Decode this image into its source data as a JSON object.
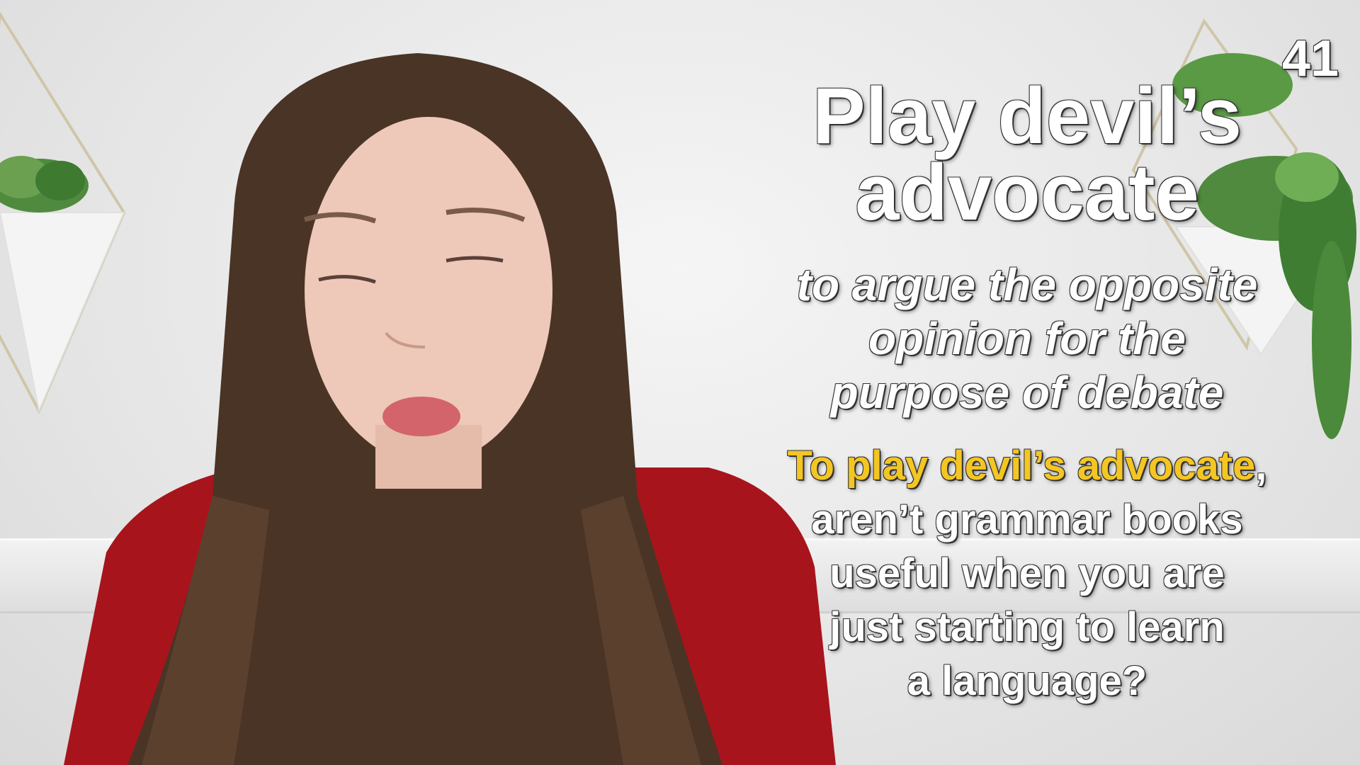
{
  "counter": "41",
  "title": {
    "line1": "Play devil’s",
    "line2": "advocate"
  },
  "definition": {
    "line1": "to argue the opposite",
    "line2": "opinion for the",
    "line3": "purpose of debate"
  },
  "example": {
    "highlight": "To play devil’s advocate",
    "line1_rest": ",",
    "line2": "aren’t grammar books",
    "line3": "useful when you are",
    "line4": "just starting to learn",
    "line5": "a language?"
  },
  "colors": {
    "highlight": "#f4c623",
    "text": "#ffffff",
    "sweater": "#a8141c",
    "hair": "#4a3426"
  }
}
